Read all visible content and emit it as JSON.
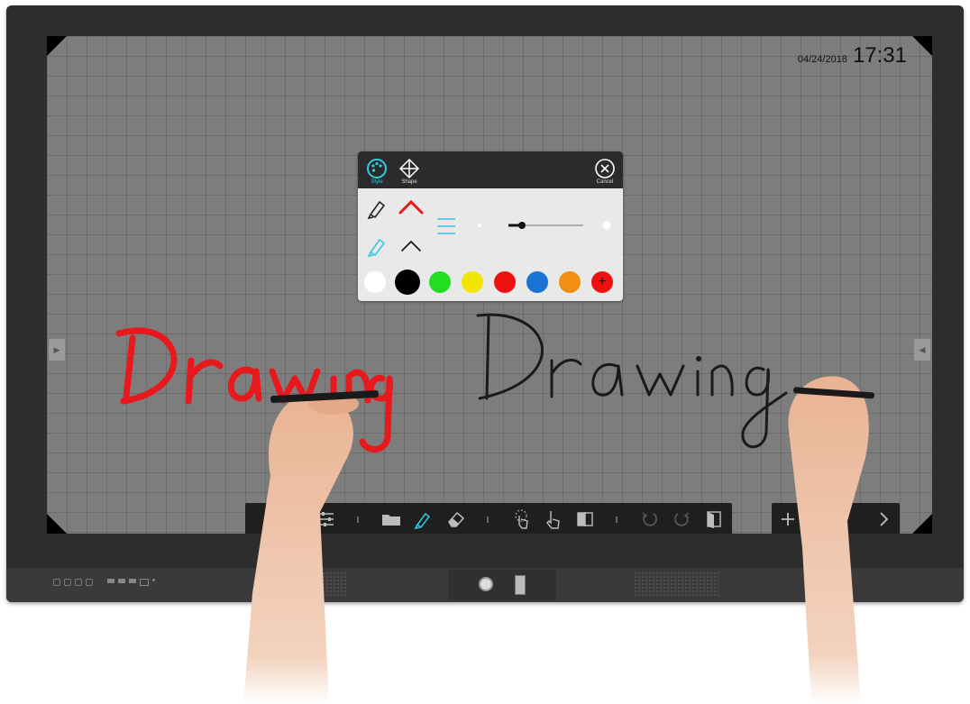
{
  "status": {
    "date": "04/24/2018",
    "time": "17:31"
  },
  "canvas": {
    "text_left": "Drawing",
    "text_right": "Drawing",
    "color_left": "#e8191c",
    "color_right": "#1a1a1a"
  },
  "dialog": {
    "tabs": [
      {
        "label": "Style",
        "icon": "palette-icon",
        "active": true
      },
      {
        "label": "Shape",
        "icon": "shape-icon",
        "active": false
      }
    ],
    "cancel_label": "Cancel",
    "pen_types": [
      "marker-pen-icon",
      "highlighter-pen-icon"
    ],
    "stroke_styles": [
      "red-stroke-icon",
      "black-stroke-icon"
    ],
    "thickness_level": 0.1,
    "colors": [
      "#ffffff",
      "#000000",
      "#22dd22",
      "#f2e600",
      "#ee1111",
      "#1a73d2",
      "#f28f12",
      "#ee1111"
    ],
    "selected_color": "#000000"
  },
  "toolbar": {
    "icons": [
      "settings-sliders-icon",
      "folder-icon",
      "pen-icon",
      "eraser-icon",
      "touch-select-icon",
      "pointer-icon",
      "split-screen-icon",
      "undo-icon",
      "redo-icon",
      "exit-icon"
    ]
  },
  "toolbar_right": {
    "icons": [
      "add-page-icon",
      "prev-page-icon",
      "next-page-icon"
    ]
  }
}
